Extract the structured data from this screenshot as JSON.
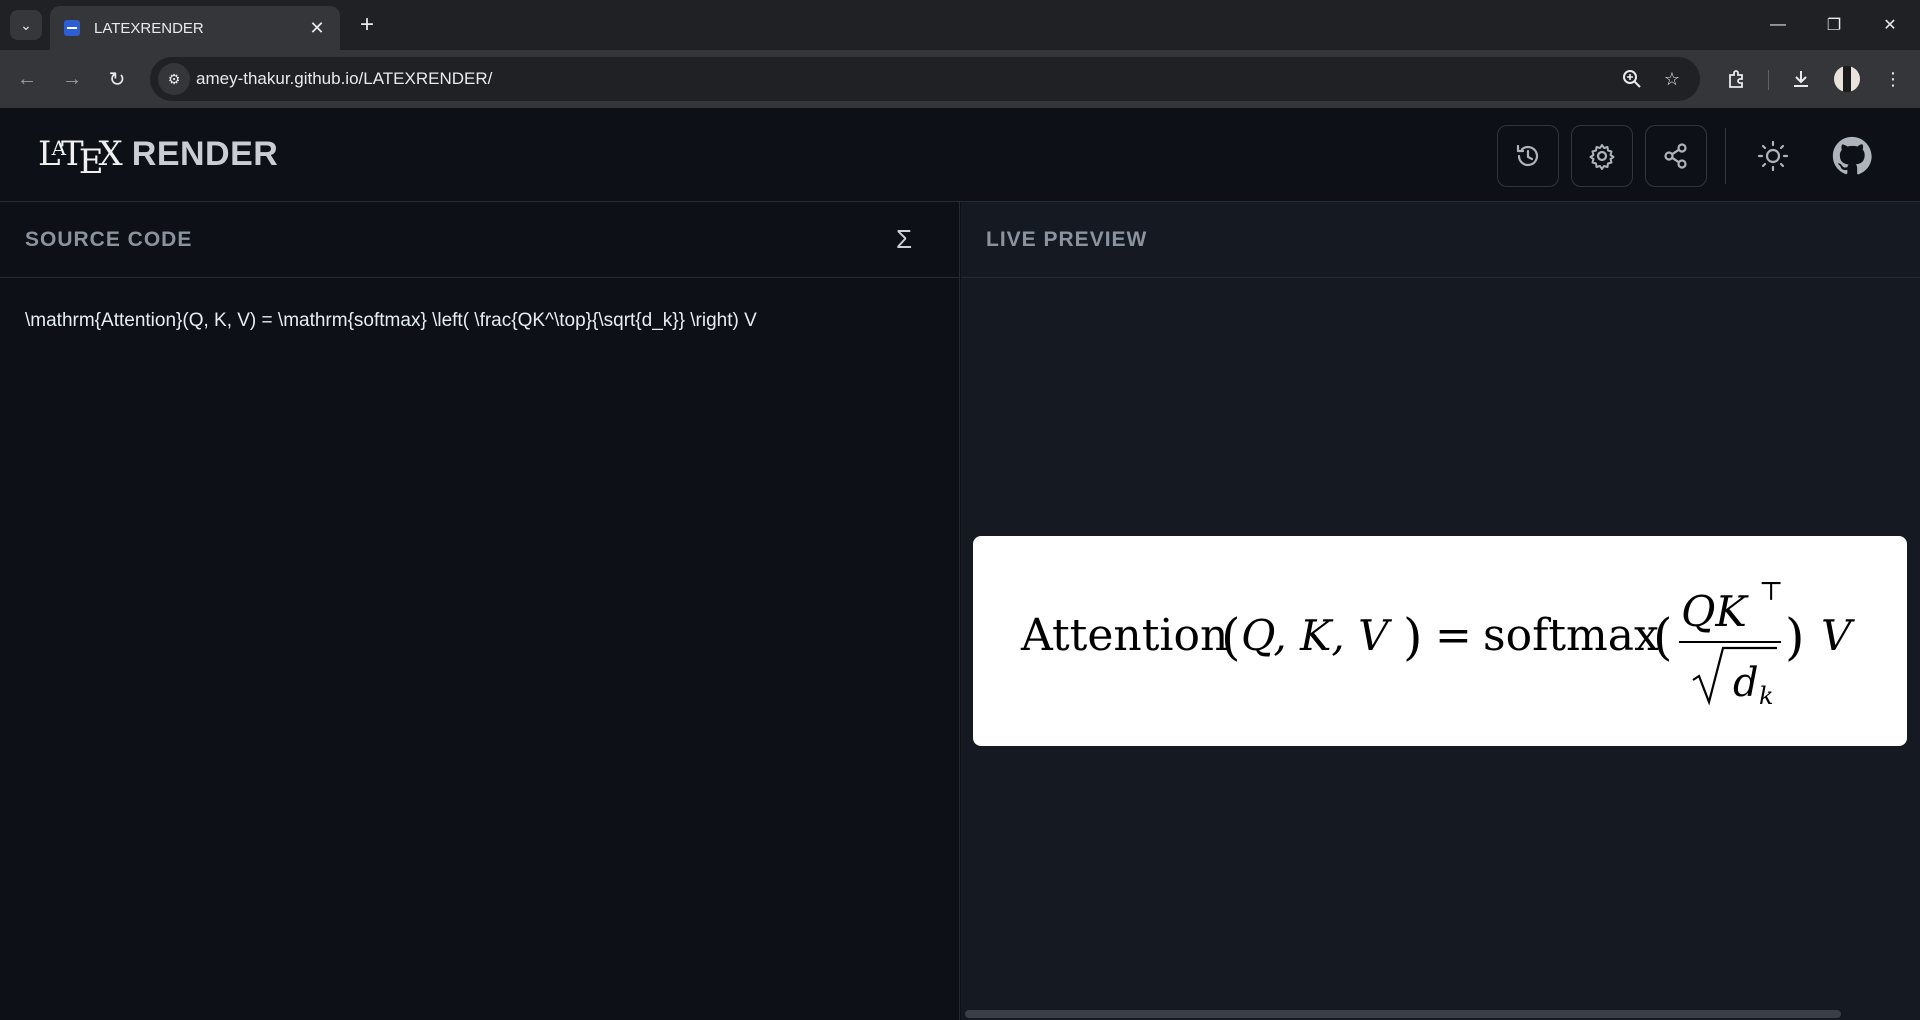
{
  "browser": {
    "tab_title": "LATEXRENDER",
    "url": "amey-thakur.github.io/LATEXRENDER/"
  },
  "app": {
    "logo_latex": "LATEX",
    "logo_render": "RENDER",
    "header_buttons": [
      "history-icon",
      "gear-icon",
      "share-icon",
      "sun-icon",
      "github-icon"
    ]
  },
  "source": {
    "title": "SOURCE CODE",
    "code": "\\mathrm{Attention}(Q, K, V) = \\mathrm{softmax} \\left( \\frac{QK^\\top}{\\sqrt{d_k}} \\right) V"
  },
  "preview": {
    "title": "LIVE PREVIEW",
    "fn_name": "Attention",
    "args": "Q, K, V",
    "softmax": "softmax",
    "numerator": "QK",
    "sup": "⊤",
    "denominator_var": "d",
    "denominator_sub": "k",
    "trailing": "V"
  }
}
